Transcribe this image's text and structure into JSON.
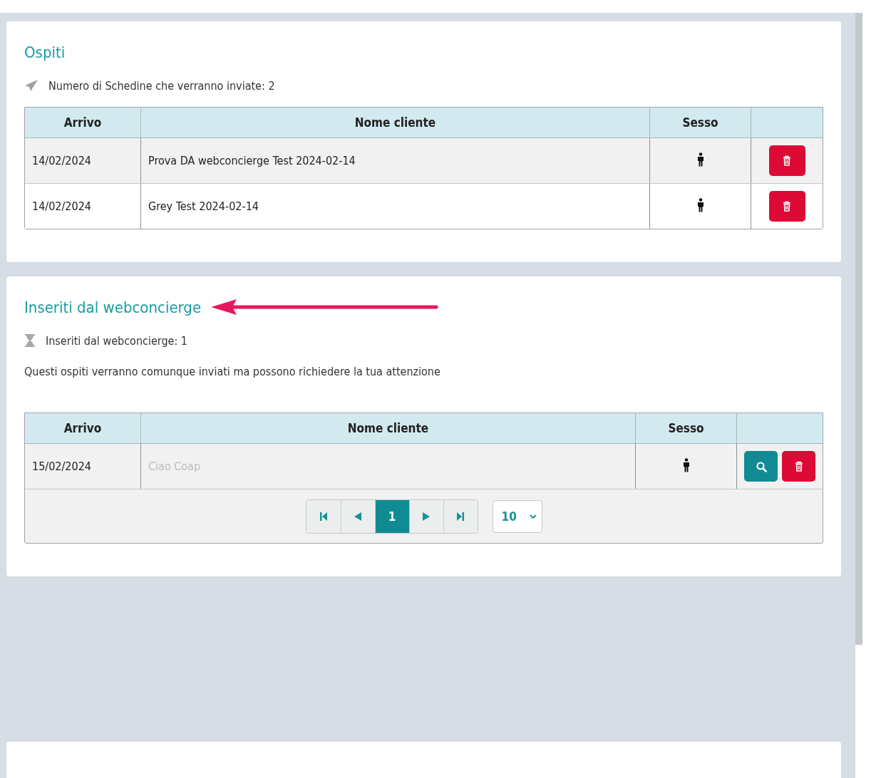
{
  "sections": [
    {
      "title": "Ospiti",
      "info": {
        "text": "Numero di Schedine che verranno inviate: 2"
      },
      "columns": [
        "Arrivo",
        "Nome cliente",
        "Sesso"
      ],
      "rows": [
        {
          "kind": "plain",
          "arrivo": "14/02/2024",
          "nome": "Prova DA webconcierge Test 2024-02-14",
          "greyed": false
        },
        {
          "kind": "plain",
          "arrivo": "14/02/2024",
          "nome": "Grey Test 2024-02-14",
          "greyed": false
        }
      ]
    },
    {
      "title": "Inseriti dal webconcierge",
      "annotation_arrow": true,
      "info": {
        "text": "Inseriti dal webconcierge: 1"
      },
      "note": "Questi ospiti verranno comunque inviati ma possono richiedere la tua attenzione",
      "columns": [
        "Arrivo",
        "Nome cliente",
        "Sesso"
      ],
      "rows": [
        {
          "kind": "reviewable",
          "arrivo": "15/02/2024",
          "nome": "Ciao Coap",
          "greyed": true
        }
      ],
      "pagination": {
        "pages": [
          {
            "label": "1",
            "selected": true
          }
        ],
        "page_size": "10"
      }
    }
  ]
}
